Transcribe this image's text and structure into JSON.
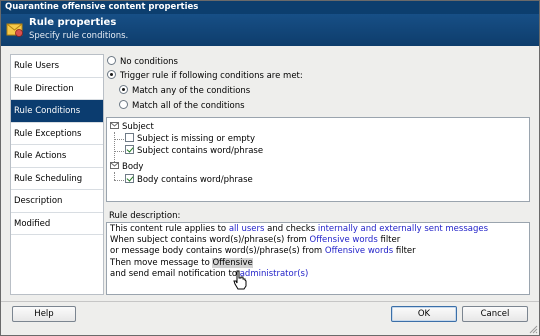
{
  "window": {
    "title": "Quarantine offensive content properties"
  },
  "header": {
    "title": "Rule properties",
    "subtitle": "Specify rule conditions.",
    "icon": "envelope-gear-icon"
  },
  "nav": {
    "items": [
      {
        "label": "Rule Users",
        "selected": false
      },
      {
        "label": "Rule Direction",
        "selected": false
      },
      {
        "label": "Rule Conditions",
        "selected": true
      },
      {
        "label": "Rule Exceptions",
        "selected": false
      },
      {
        "label": "Rule Actions",
        "selected": false
      },
      {
        "label": "Rule Scheduling",
        "selected": false
      },
      {
        "label": "Description",
        "selected": false
      },
      {
        "label": "Modified",
        "selected": false
      }
    ]
  },
  "conditions": {
    "no_conditions": "No conditions",
    "trigger": "Trigger rule if following conditions are met:",
    "match_any": "Match any of the conditions",
    "match_all": "Match all of the conditions",
    "selected_mode": "trigger",
    "selected_match": "any"
  },
  "tree": {
    "subject_group": "Subject",
    "subject_missing": "Subject is missing or empty",
    "subject_missing_checked": false,
    "subject_contains": "Subject contains word/phrase",
    "subject_contains_checked": true,
    "body_group": "Body",
    "body_contains": "Body contains word/phrase",
    "body_contains_checked": true
  },
  "description": {
    "label": "Rule description:",
    "line1_a": "This content rule applies to ",
    "link_users": "all users",
    "line1_b": " and checks ",
    "link_direction": "internally and externally sent messages",
    "line2_a": "When subject contains word(s)/phrase(s) from ",
    "link_words1": "Offensive words",
    "line2_b": " filter",
    "line3_a": "or message body contains word(s)/phrase(s) from ",
    "link_words2": "Offensive words",
    "line3_b": " filter",
    "line4_a": "Then move message to ",
    "folder": "Offensive",
    "line5_a": "and send email notification to ",
    "link_admin": "administrator(s)"
  },
  "buttons": {
    "help": "Help",
    "ok": "OK",
    "cancel": "Cancel"
  },
  "colors": {
    "accent": "#0b3c6f",
    "link": "#1f1fc8",
    "title_bar": "#0c3e6e"
  }
}
